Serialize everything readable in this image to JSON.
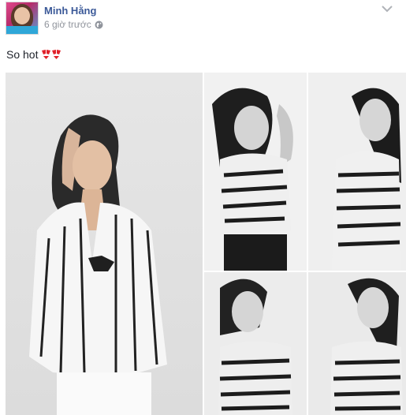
{
  "post": {
    "author_name": "Minh Hằng",
    "timestamp": "6 giờ trước",
    "privacy_icon": "globe-icon",
    "menu_icon": "chevron-down-icon",
    "body_text": "So hot",
    "body_emoji": "bikini-emoji"
  },
  "photos": [
    {
      "name": "photo-main",
      "subject": "woman in striped white shirt"
    },
    {
      "name": "photo-top-left"
    },
    {
      "name": "photo-top-right"
    },
    {
      "name": "photo-bottom-left"
    },
    {
      "name": "photo-bottom-right"
    }
  ],
  "colors": {
    "author_link": "#3b5998",
    "meta_text": "#90949c",
    "body_text": "#1d2129",
    "emoji_red": "#e0232b"
  }
}
